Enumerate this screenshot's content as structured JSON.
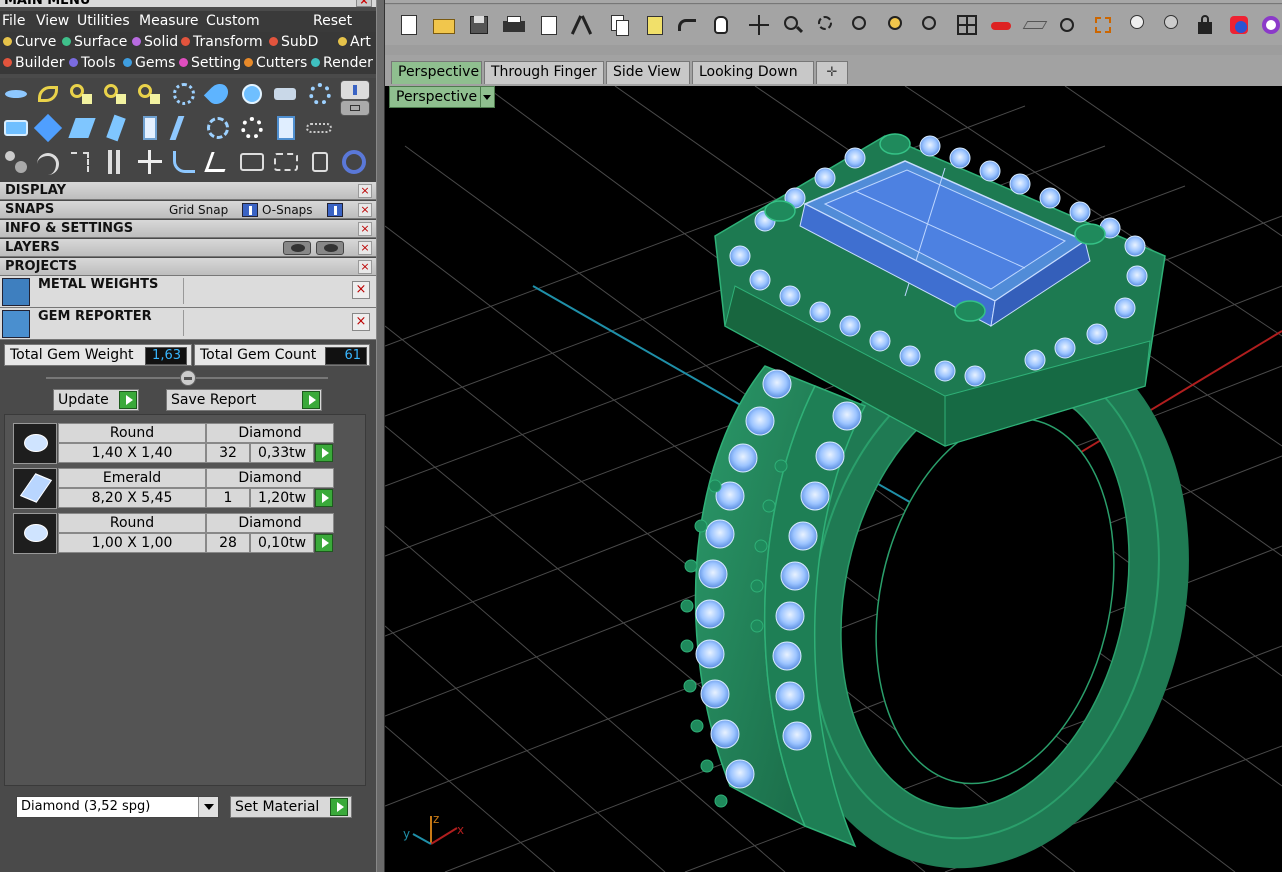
{
  "main_menu": {
    "title": "MAIN MENU",
    "close": "×"
  },
  "menubar": {
    "file": "File",
    "view": "View",
    "utilities": "Utilities",
    "measure": "Measure",
    "custom": "Custom",
    "reset": "Reset"
  },
  "modules_row1": [
    {
      "label": "Curve",
      "color": "#e6c34a"
    },
    {
      "label": "Surface",
      "color": "#3fc08a"
    },
    {
      "label": "Solid",
      "color": "#b86be0"
    },
    {
      "label": "Transform",
      "color": "#e2543d"
    },
    {
      "label": "SubD",
      "color": "#e2543d"
    },
    {
      "label": "Art",
      "color": "#e6c34a"
    }
  ],
  "modules_row2": [
    {
      "label": "Builder",
      "color": "#e2543d"
    },
    {
      "label": "Tools",
      "color": "#7a6be0"
    },
    {
      "label": "Gems",
      "color": "#3f9ee0"
    },
    {
      "label": "Setting",
      "color": "#e04ec0"
    },
    {
      "label": "Cutters",
      "color": "#e88a2a"
    },
    {
      "label": "Render",
      "color": "#3fc0c0"
    }
  ],
  "sections": {
    "display": "DISPLAY",
    "snaps": "SNAPS",
    "grid_snap": "Grid Snap",
    "o_snaps": "O-Snaps",
    "info": "INFO & SETTINGS",
    "layers": "LAYERS",
    "projects": "PROJECTS"
  },
  "plugins": {
    "metal_weights": "METAL WEIGHTS",
    "gem_reporter": "GEM REPORTER"
  },
  "gem_reporter": {
    "total_weight_label": "Total Gem Weight",
    "total_weight": "1,63",
    "total_count_label": "Total Gem Count",
    "total_count": "61",
    "update": "Update",
    "save_report": "Save Report",
    "gems": [
      {
        "shape": "Round",
        "material": "Diamond",
        "size": "1,40 X 1,40",
        "count": "32",
        "weight": "0,33tw"
      },
      {
        "shape": "Emerald",
        "material": "Diamond",
        "size": "8,20 X 5,45",
        "count": "1",
        "weight": "1,20tw"
      },
      {
        "shape": "Round",
        "material": "Diamond",
        "size": "1,00 X 1,00",
        "count": "28",
        "weight": "0,10tw"
      }
    ],
    "material_select": "Diamond    (3,52 spg)",
    "set_material": "Set Material"
  },
  "viewport_tabs": [
    "Perspective",
    "Through Finger",
    "Side View",
    "Looking Down"
  ],
  "viewport": {
    "label": "Perspective",
    "axis_x": "x",
    "axis_y": "y",
    "axis_z": "z"
  }
}
